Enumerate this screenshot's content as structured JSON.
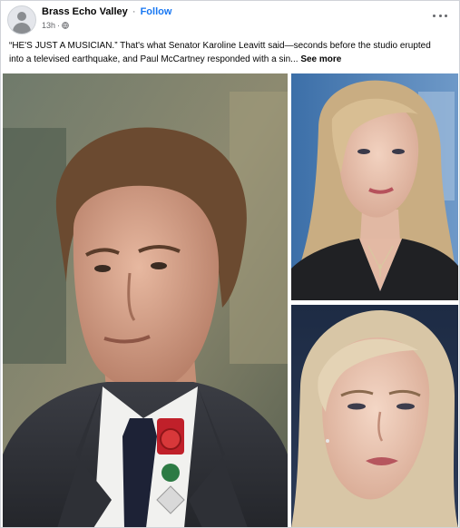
{
  "post": {
    "page_name": "Brass Echo Valley",
    "separator": "·",
    "follow_label": "Follow",
    "time": "13h",
    "time_separator": "·",
    "caption": "“HE'S JUST A MUSICIAN.” That's what Senator Karoline Leavitt said—seconds before the studio erupted into a televised earthquake, and Paul McCartney responded with a sin...",
    "see_more": "See more",
    "more_icon": "more-horizontal-icon",
    "audience_icon": "globe-icon"
  },
  "media": {
    "photos": [
      {
        "name": "photo-man-suit"
      },
      {
        "name": "photo-woman-top"
      },
      {
        "name": "photo-woman-bottom"
      }
    ]
  }
}
